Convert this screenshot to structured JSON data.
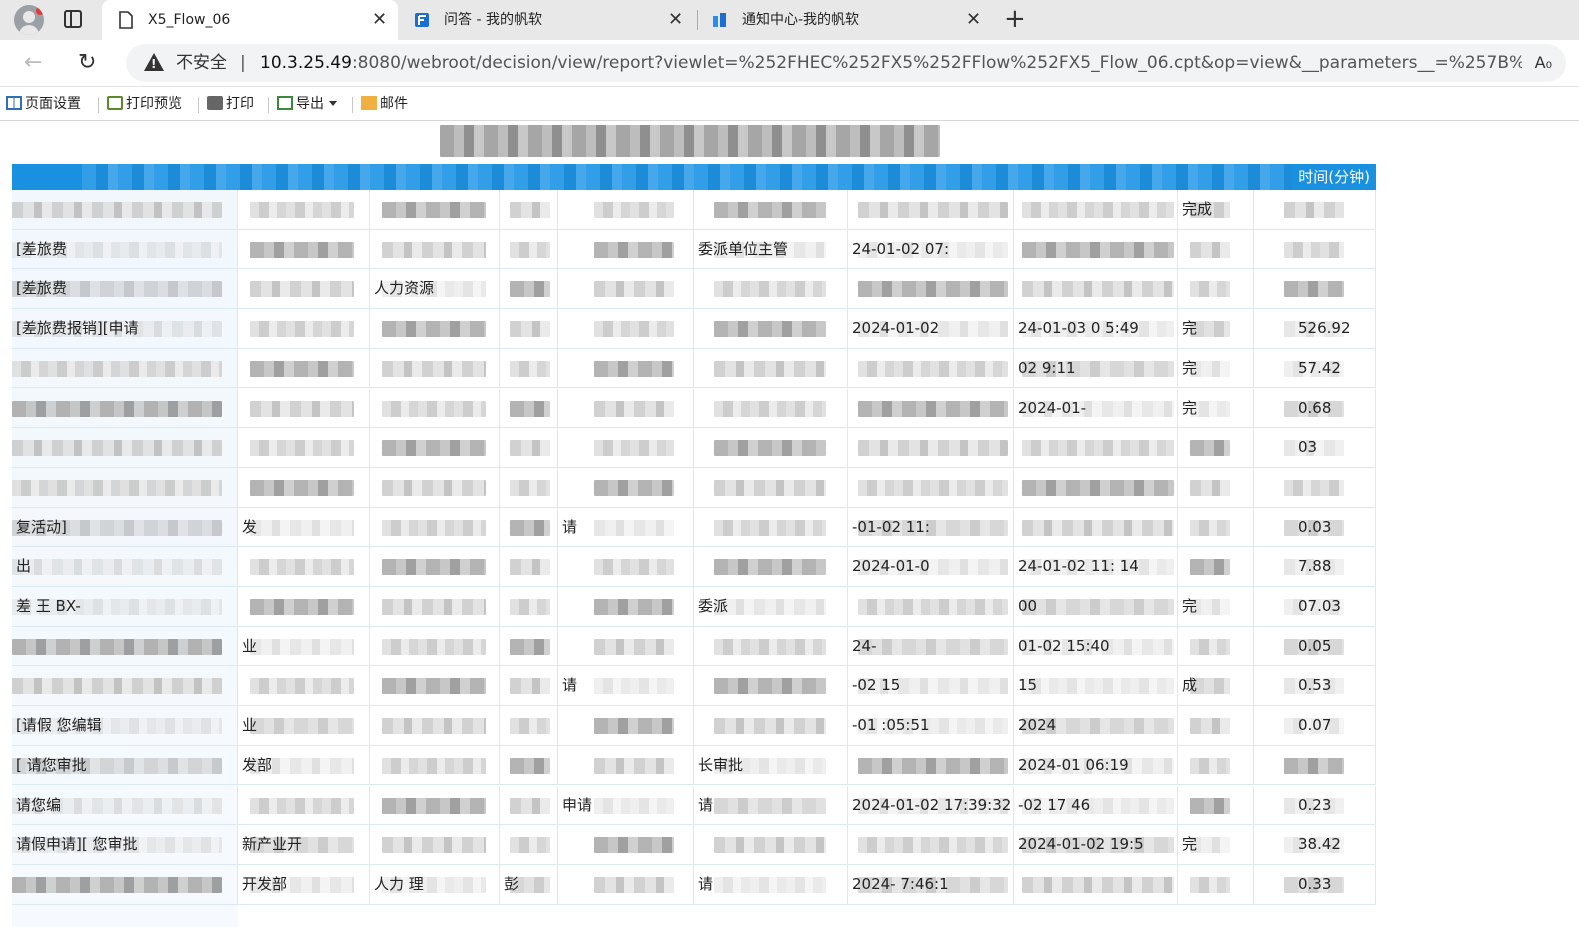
{
  "browser": {
    "tabs": [
      {
        "title": "X5_Flow_06",
        "icon": "document-icon",
        "active": true
      },
      {
        "title": "问答 - 我的帆软",
        "icon": "fanruan-logo-icon",
        "active": false
      },
      {
        "title": "通知中心-我的帆软",
        "icon": "fanruan-notify-icon",
        "active": false
      }
    ],
    "security_label": "不安全",
    "url_host": "10.3.25.49",
    "url_rest": ":8080/webroot/decision/view/report?viewlet=%252FHEC%252FX5%252FFlow%252FX5_Flow_06.cpt&op=view&__parameters__=%257B%2522__pi__%252..."
  },
  "toolbar": {
    "page_setup": "页面设置",
    "print_preview": "打印预览",
    "print": "打印",
    "export": "导出",
    "mail": "邮件"
  },
  "report": {
    "last_column_header": "时间(分钟)",
    "rows": [
      {
        "c0": "",
        "c1": "",
        "c2": "",
        "c4": "",
        "c5": "",
        "c6": "",
        "c7": "",
        "c8": "完成",
        "c9": ""
      },
      {
        "c0": "[差旅费",
        "c1": "",
        "c2": "",
        "c4": "",
        "c5": "委派单位主管",
        "c6": "24-01-02 07:",
        "c7": "",
        "c8": "",
        "c9": ""
      },
      {
        "c0": "[差旅费",
        "c1": "",
        "c2": "人力资源",
        "c4": "",
        "c5": "",
        "c6": "",
        "c7": "",
        "c8": "",
        "c9": ""
      },
      {
        "c0": "[差旅费报销][申请",
        "c1": "",
        "c2": "",
        "c4": "",
        "c5": "",
        "c6": "2024-01-02",
        "c7": "24-01-03 0 5:49",
        "c8": "完",
        "c9": "526.92"
      },
      {
        "c0": "",
        "c1": "",
        "c2": "",
        "c4": "",
        "c5": "",
        "c6": "",
        "c7": "02 9:11",
        "c8": "完",
        "c9": "57.42"
      },
      {
        "c0": "",
        "c1": "",
        "c2": "",
        "c4": "",
        "c5": "",
        "c6": "",
        "c7": "2024-01-",
        "c8": "完",
        "c9": "0.68"
      },
      {
        "c0": "",
        "c1": "",
        "c2": "",
        "c4": "",
        "c5": "",
        "c6": "",
        "c7": "",
        "c8": "",
        "c9": "03"
      },
      {
        "c0": "",
        "c1": "",
        "c2": "",
        "c4": "",
        "c5": "",
        "c6": "",
        "c7": "",
        "c8": "",
        "c9": ""
      },
      {
        "c0": "复活动]",
        "c1": "发",
        "c2": "",
        "c4": "请",
        "c5": "",
        "c6": "-01-02 11:",
        "c7": "",
        "c8": "",
        "c9": "0.03"
      },
      {
        "c0": "出",
        "c1": "",
        "c2": "",
        "c4": "",
        "c5": "",
        "c6": "2024-01-0",
        "c7": "24-01-02 11: 14",
        "c8": "",
        "c9": "7.88"
      },
      {
        "c0": "差 王 BX-",
        "c1": "",
        "c2": "",
        "c4": "",
        "c5": "委派",
        "c6": "",
        "c7": "00",
        "c8": "完",
        "c9": "07.03"
      },
      {
        "c0": "",
        "c1": "业",
        "c2": "",
        "c4": "",
        "c5": "",
        "c6": "24-",
        "c7": "01-02 15:40",
        "c8": "",
        "c9": "0.05"
      },
      {
        "c0": "",
        "c1": "",
        "c2": "",
        "c4": "请",
        "c5": "",
        "c6": "-02 15",
        "c7": "15",
        "c8": "成",
        "c9": "0.53"
      },
      {
        "c0": "[请假 您编辑",
        "c1": "业",
        "c2": "",
        "c4": "",
        "c5": "",
        "c6": "-01 :05:51",
        "c7": "2024",
        "c8": "",
        "c9": "0.07"
      },
      {
        "c0": "[ 请您审批",
        "c1": "发部",
        "c2": "",
        "c4": "",
        "c5": "长审批",
        "c6": "",
        "c7": "2024-01 06:19",
        "c8": "",
        "c9": ""
      },
      {
        "c0": "请您编",
        "c1": "",
        "c2": "",
        "c4": "申请",
        "c5": "请",
        "c6": "2024-01-02 17:39:32",
        "c7": "-02 17 46",
        "c8": "",
        "c9": "0.23"
      },
      {
        "c0": "请假申请][ 您审批",
        "c1": "新产业开",
        "c2": "",
        "c4": "",
        "c5": "",
        "c6": "",
        "c7": "2024-01-02 19:5",
        "c8": "完",
        "c9": "38.42"
      },
      {
        "c0": "",
        "c1": "开发部",
        "c2": "人力 理",
        "c3": "彭",
        "c4": "",
        "c5": "请",
        "c6": "2024- 7:46:1",
        "c7": "",
        "c8": "",
        "c9": "0.33"
      }
    ]
  }
}
